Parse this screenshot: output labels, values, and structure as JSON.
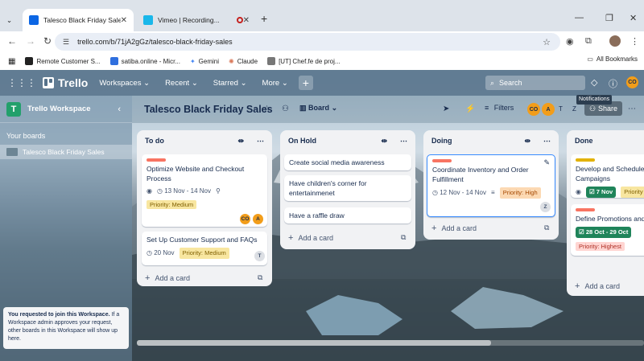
{
  "browser": {
    "tabs": [
      {
        "title": "Talesco Black Friday Sales | Trello"
      },
      {
        "title": "Vimeo | Recording..."
      }
    ],
    "url": "trello.com/b/71jA2gGz/talesco-black-friday-sales",
    "bookmarks": [
      "Remote Customer S...",
      "satiba.online - Micr...",
      "Gemini",
      "Claude",
      "[UT] Chef.fe de proj..."
    ],
    "all_bookmarks": "All Bookmarks"
  },
  "trello": {
    "logo": "Trello",
    "nav": {
      "workspaces": "Workspaces",
      "recent": "Recent",
      "starred": "Starred",
      "more": "More"
    },
    "search_placeholder": "Search",
    "user_initials": "CO"
  },
  "sidebar": {
    "workspace_initial": "T",
    "workspace_name": "Trello Workspace",
    "your_boards": "Your boards",
    "boards": [
      "Talesco Black Friday Sales"
    ],
    "notice_bold": "You requested to join this Workspace.",
    "notice_text": " If a Workspace admin approves your request, other boards in this Workspace will show up here."
  },
  "board": {
    "title": "Talesco Black Friday Sales",
    "view": "Board",
    "filters": "Filters",
    "members": [
      "CO",
      "A",
      "T",
      "Z"
    ],
    "share": "Share",
    "tooltip": "Notifications"
  },
  "lists": [
    {
      "title": "To do",
      "cards": [
        {
          "title": "Optimize Website and Checkout Process",
          "date": "13 Nov - 14 Nov",
          "priority": "Priority: Medium",
          "members": [
            "CO",
            "A"
          ]
        },
        {
          "title": "Set Up Customer Support and FAQs",
          "date": "20 Nov",
          "priority": "Priority: Medium",
          "members": [
            "T"
          ]
        }
      ],
      "add": "Add a card"
    },
    {
      "title": "On Hold",
      "cards": [
        {
          "title": "Create social media awareness"
        },
        {
          "title": "Have children's corner for entertainmenet"
        },
        {
          "title": "Have a raffle draw"
        }
      ],
      "add": "Add a card"
    },
    {
      "title": "Doing",
      "cards": [
        {
          "title": "Coordinate Inventory and Order Fulfillment",
          "date": "12 Nov - 14 Nov",
          "priority": "Priority: High",
          "members": [
            "Z"
          ]
        }
      ],
      "add": "Add a card"
    },
    {
      "title": "Done",
      "cards": [
        {
          "title": "Develop and Schedule Campaigns",
          "date": "7 Nov",
          "priority": "Priority"
        },
        {
          "title": "Define Promotions and",
          "date": "28 Oct - 29 Oct",
          "priority": "Priority: Highest"
        }
      ],
      "add": "Add a card"
    }
  ],
  "colors": {
    "label_red": "#f87462",
    "label_yellow": "#e2b203",
    "accent": "#388bff",
    "avatar_orange": "#f29d1a"
  }
}
